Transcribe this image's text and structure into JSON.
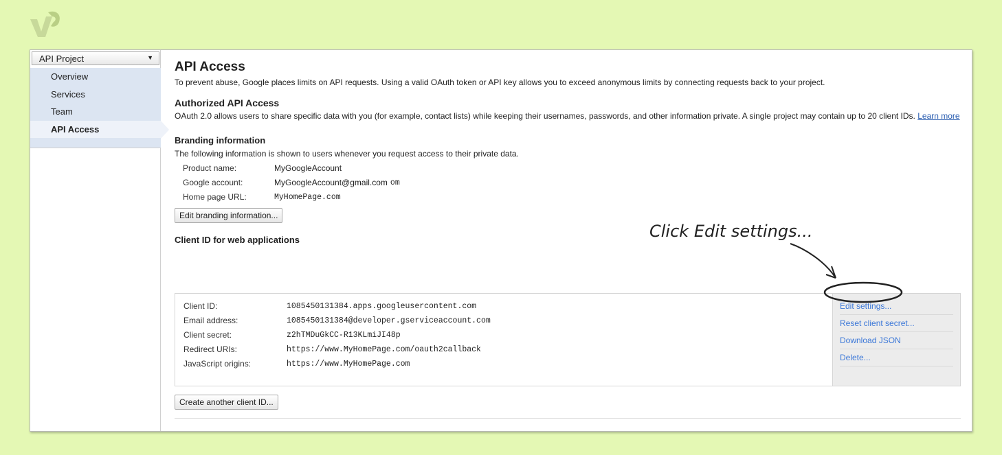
{
  "sidebar": {
    "project_select": "API Project",
    "items": [
      {
        "label": "Overview"
      },
      {
        "label": "Services"
      },
      {
        "label": "Team"
      },
      {
        "label": "API Access"
      }
    ]
  },
  "main": {
    "title": "API Access",
    "description": "To prevent abuse, Google places limits on API requests. Using a valid OAuth token or API key allows you to exceed anonymous limits by connecting requests back to your project.",
    "authorized": {
      "heading": "Authorized API Access",
      "text": "OAuth 2.0 allows users to share specific data with you (for example, contact lists) while keeping their usernames, passwords, and other information private. A single project may contain up to 20 client IDs.",
      "learn_more": "Learn more"
    },
    "branding": {
      "heading": "Branding information",
      "text": "The following information is shown to users whenever you request access to their private data.",
      "rows": [
        {
          "label": "Product name:",
          "value": "MyGoogleAccount",
          "extra": ""
        },
        {
          "label": "Google account:",
          "value": "MyGoogleAccount@gmail.com",
          "extra": "om"
        },
        {
          "label": "Home page URL:",
          "value": "MyHomePage.com",
          "extra": ""
        }
      ],
      "edit_button": "Edit branding information..."
    },
    "client": {
      "heading": "Client ID for web applications",
      "rows": [
        {
          "label": "Client ID:",
          "value": "1085450131384.apps.googleusercontent.com"
        },
        {
          "label": "Email address:",
          "value": "1085450131384@developer.gserviceaccount.com"
        },
        {
          "label": "Client secret:",
          "value": "z2hTMDuGkCC-R13KLmiJI48p"
        },
        {
          "label": "Redirect URIs:",
          "value": "https://www.MyHomePage.com/oauth2callback"
        },
        {
          "label": "JavaScript origins:",
          "value": "https://www.MyHomePage.com"
        }
      ],
      "actions": [
        "Edit settings...",
        "Reset client secret...",
        "Download JSON",
        "Delete..."
      ],
      "create_button": "Create another client ID..."
    },
    "annotation": "Click Edit settings..."
  }
}
